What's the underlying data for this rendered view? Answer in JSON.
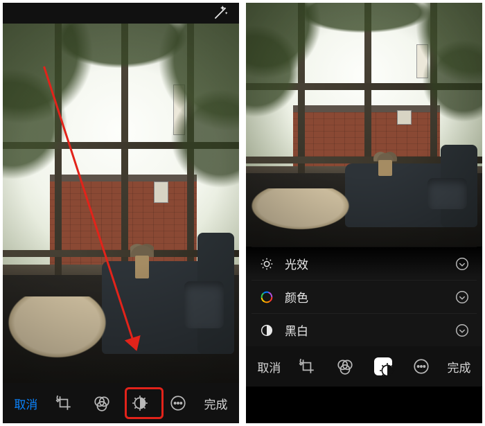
{
  "colors": {
    "accent_blue": "#0a84ff",
    "highlight_red": "#e2231a"
  },
  "left": {
    "cancel": "取消",
    "done": "完成",
    "icons": {
      "wand": "magic-wand-icon",
      "crop": "crop-rotate-icon",
      "filters": "filters-icon",
      "adjust": "adjust-icon",
      "more": "more-icon"
    }
  },
  "right": {
    "cancel": "取消",
    "done": "完成",
    "adjustments": [
      {
        "id": "light",
        "label": "光效"
      },
      {
        "id": "color",
        "label": "颜色"
      },
      {
        "id": "bw",
        "label": "黑白"
      }
    ],
    "icons": {
      "crop": "crop-rotate-icon",
      "filters": "filters-icon",
      "adjust": "adjust-icon",
      "more": "more-icon"
    }
  }
}
